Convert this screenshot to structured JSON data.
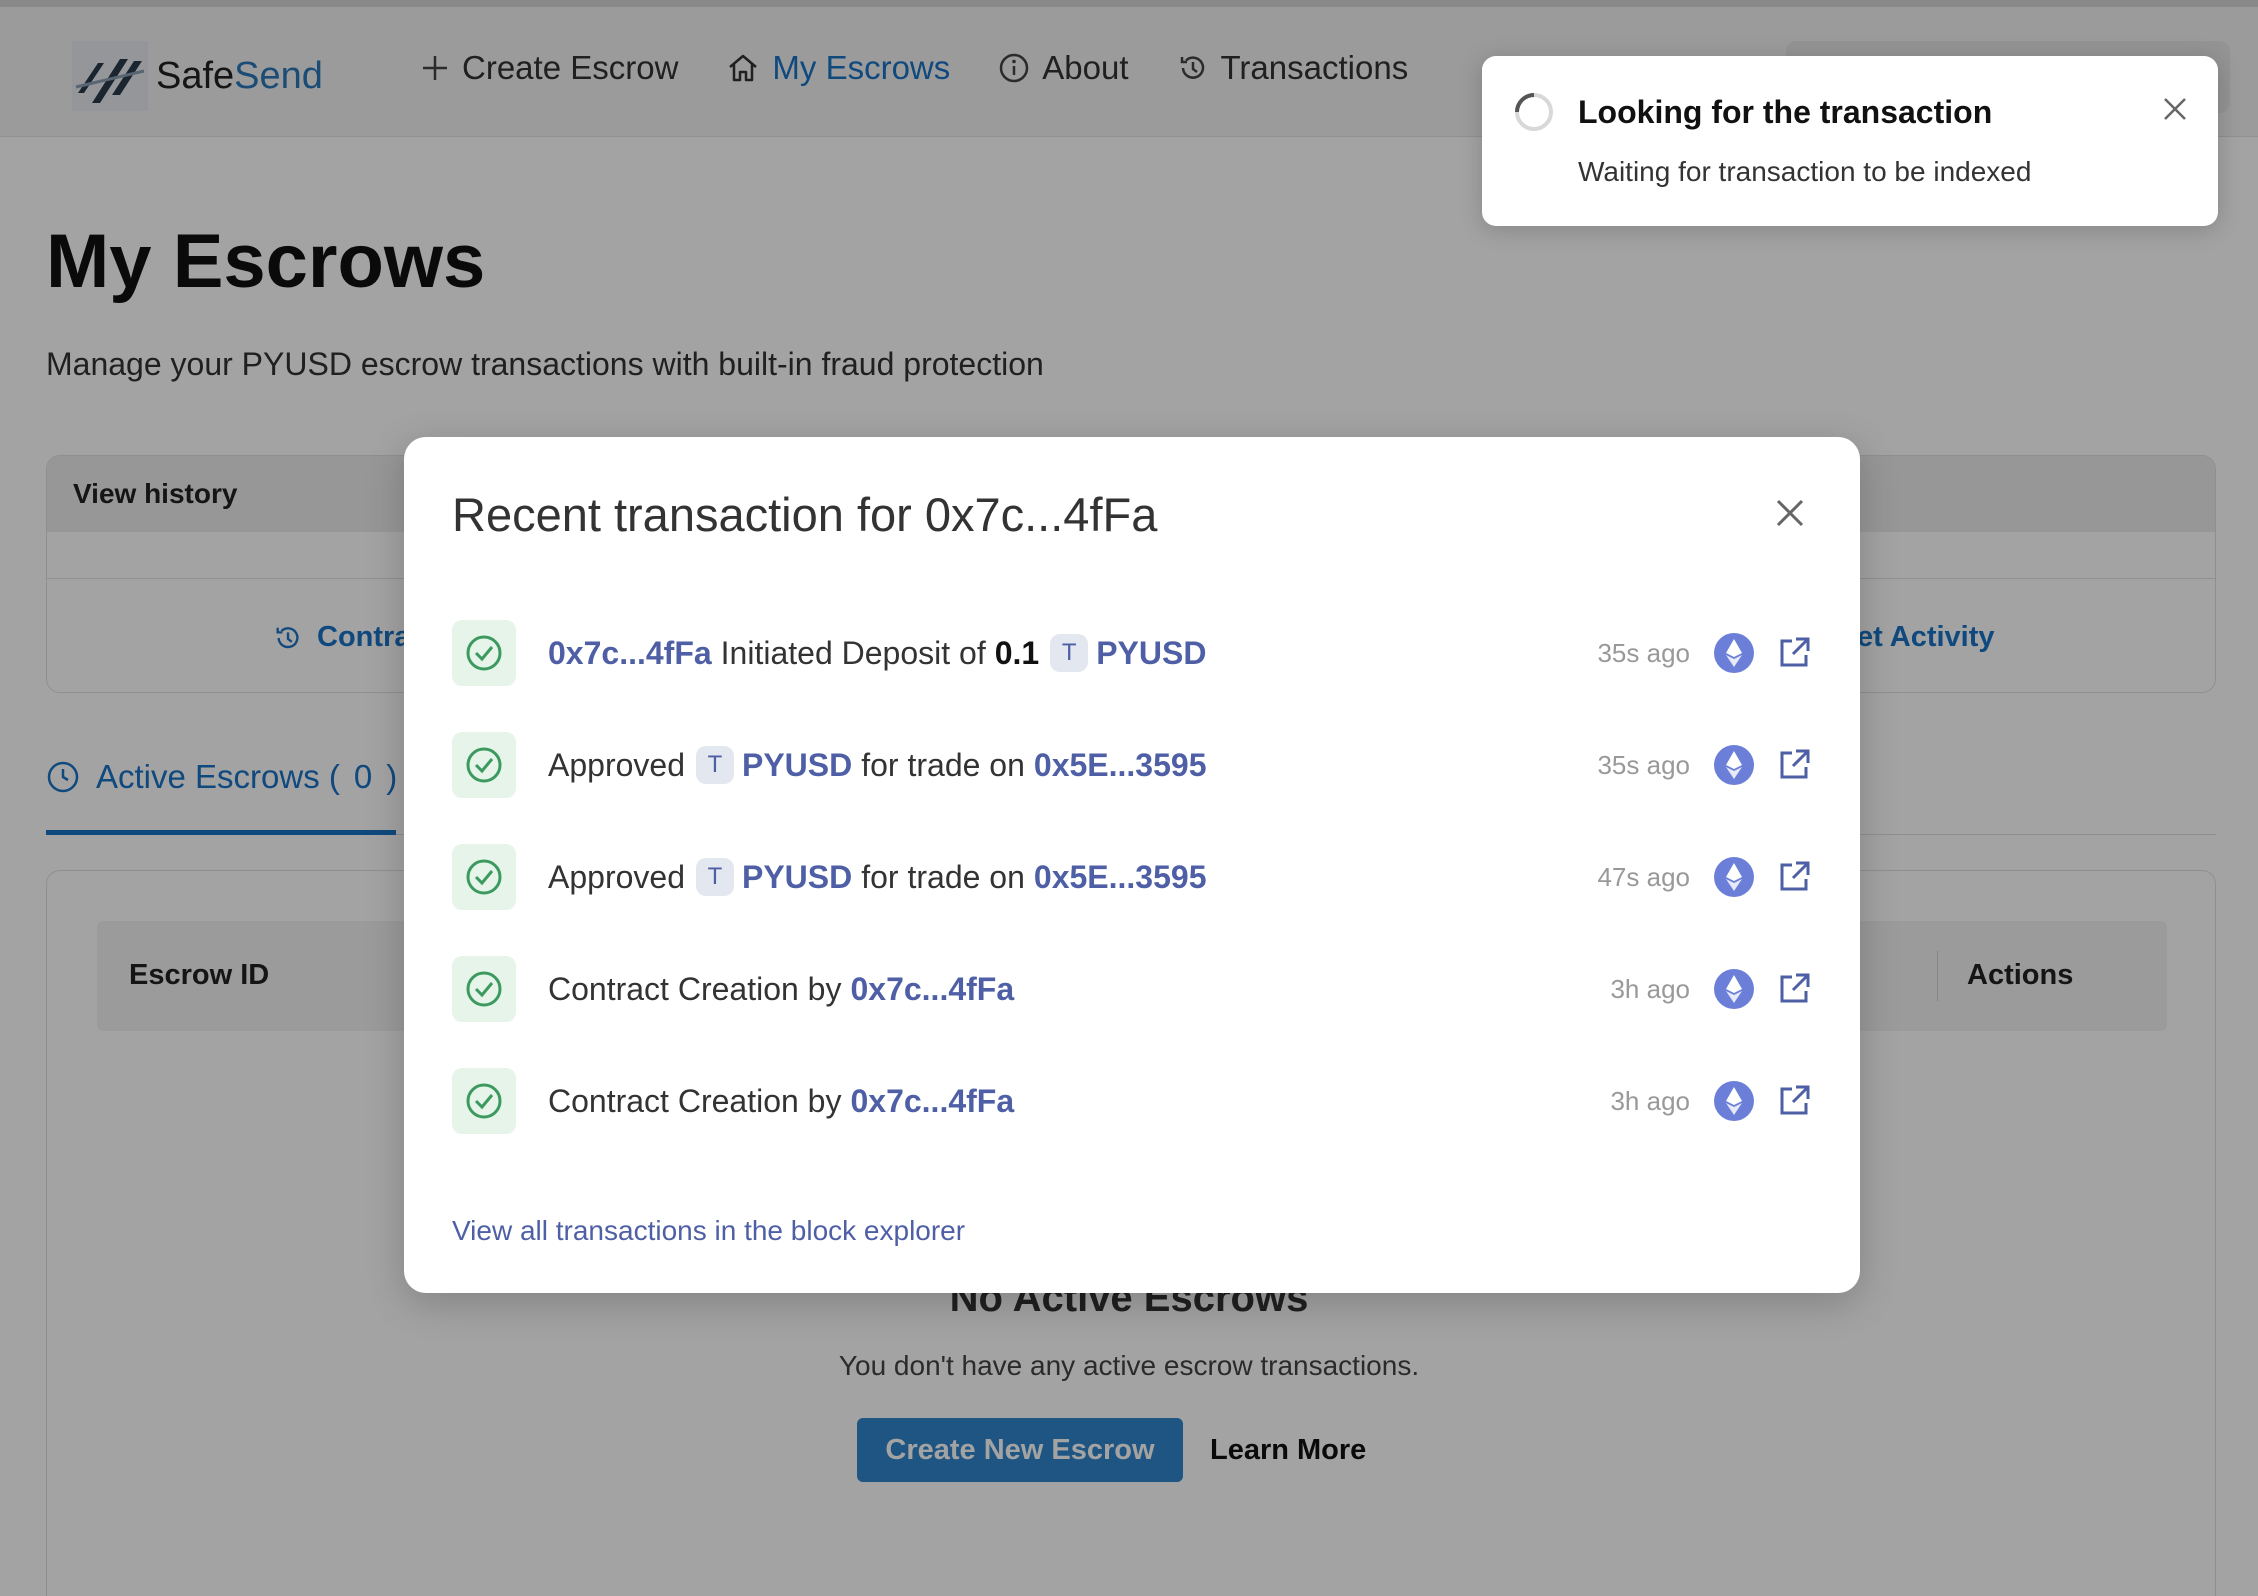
{
  "header": {
    "logo_part1": "Safe",
    "logo_part2": "Send",
    "nav": [
      {
        "label": "Create Escrow",
        "icon": "plus-icon"
      },
      {
        "label": "My Escrows",
        "icon": "home-icon"
      },
      {
        "label": "About",
        "icon": "info-icon"
      },
      {
        "label": "Transactions",
        "icon": "history-icon"
      }
    ]
  },
  "page": {
    "title": "My Escrows",
    "subtitle": "Manage your PYUSD escrow transactions with built-in fraud protection"
  },
  "history": {
    "header": "View history",
    "link_left": "Contra",
    "link_right": "et Activity"
  },
  "tabs": {
    "active_label": "Active Escrows (",
    "active_count": "0",
    "active_close": ")"
  },
  "table": {
    "col_escrow_id": "Escrow ID",
    "col_actions": "Actions"
  },
  "empty_state": {
    "title": "No Active Escrows",
    "text": "You don't have any active escrow transactions.",
    "primary_button": "Create New Escrow",
    "secondary_button": "Learn More"
  },
  "modal": {
    "title": "Recent transaction for 0x7c...4fFa",
    "footer_link": "View all transactions in the block explorer",
    "transactions": [
      {
        "p1": "0x7c...4fFa",
        "p2": "Initiated Deposit of",
        "p3": "0.1",
        "token": "T",
        "p4": "PYUSD",
        "time": "35s ago"
      },
      {
        "p1": "Approved",
        "token": "T",
        "p2": "PYUSD",
        "p3": "for trade on",
        "p4": "0x5E...3595",
        "time": "35s ago"
      },
      {
        "p1": "Approved",
        "token": "T",
        "p2": "PYUSD",
        "p3": "for trade on",
        "p4": "0x5E...3595",
        "time": "47s ago"
      },
      {
        "p1": "Contract Creation by",
        "p2": "0x7c...4fFa",
        "time": "3h ago"
      },
      {
        "p1": "Contract Creation by",
        "p2": "0x7c...4fFa",
        "time": "3h ago"
      }
    ]
  },
  "toast": {
    "title": "Looking for the transaction",
    "text": "Waiting for transaction to be indexed"
  },
  "colors": {
    "accent": "#1a72c4",
    "link": "#4e5fa6",
    "success": "#3c9a5f",
    "eth": "#6c7fd8"
  }
}
